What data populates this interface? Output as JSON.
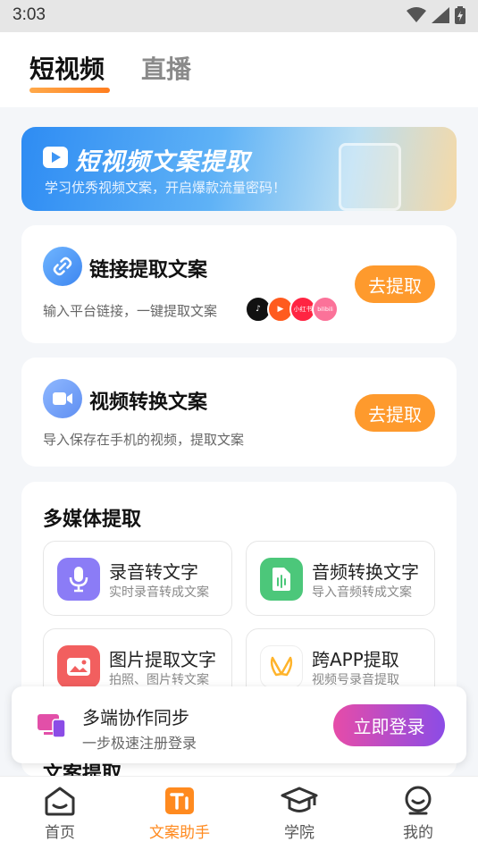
{
  "status_bar": {
    "time": "3:03"
  },
  "tabs": [
    {
      "label": "短视频",
      "active": true
    },
    {
      "label": "直播",
      "active": false
    }
  ],
  "banner": {
    "title": "短视频文案提取",
    "subtitle": "学习优秀视频文案，开启爆款流量密码！"
  },
  "link_card": {
    "title": "链接提取文案",
    "description": "输入平台链接，一键提取文案",
    "button": "去提取",
    "platforms": [
      "douyin",
      "kuaishou",
      "小红书",
      "bilibili"
    ]
  },
  "video_card": {
    "title": "视频转换文案",
    "description": "导入保存在手机的视频，提取文案",
    "button": "去提取"
  },
  "media_section": {
    "title": "多媒体提取",
    "items": [
      {
        "title": "录音转文字",
        "subtitle": "实时录音转成文案",
        "icon": "microphone-icon",
        "color": "#8b7cf6"
      },
      {
        "title": "音频转换文字",
        "subtitle": "导入音频转成文案",
        "icon": "audio-file-icon",
        "color": "#4cc77a"
      },
      {
        "title": "图片提取文字",
        "subtitle": "拍照、图片转文案",
        "icon": "image-icon",
        "color": "#f25f5f"
      },
      {
        "title": "跨APP提取",
        "subtitle": "视频号录音提取",
        "icon": "butterfly-icon",
        "color": "#ffb42b"
      }
    ]
  },
  "peek_section": {
    "title": "文案提取"
  },
  "login_bar": {
    "title": "多端协作同步",
    "subtitle": "一步极速注册登录",
    "button": "立即登录"
  },
  "bottom_nav": [
    {
      "label": "首页",
      "icon": "home-icon",
      "active": false
    },
    {
      "label": "文案助手",
      "icon": "text-assistant-icon",
      "active": true
    },
    {
      "label": "学院",
      "icon": "graduation-cap-icon",
      "active": false
    },
    {
      "label": "我的",
      "icon": "profile-icon",
      "active": false
    }
  ],
  "colors": {
    "accent": "#fe9a2d",
    "login_gradient": [
      "#e64ca8",
      "#8b4ce6"
    ]
  }
}
